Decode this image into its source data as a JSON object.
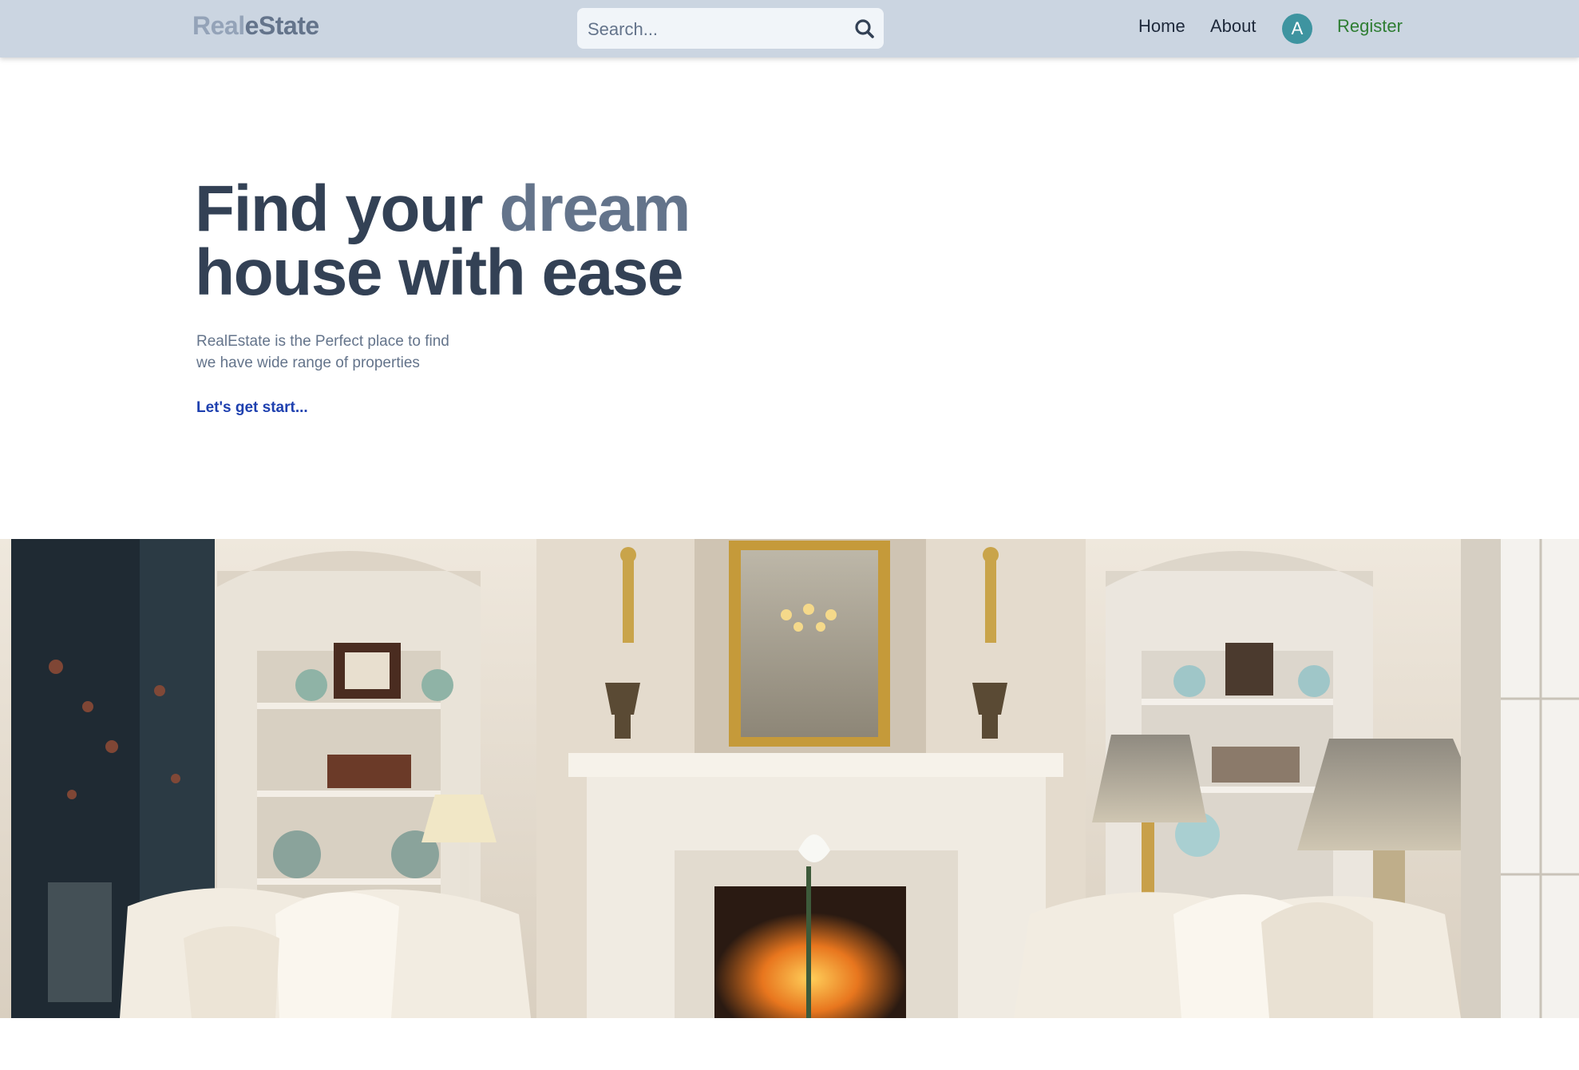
{
  "nav": {
    "logo_part1": "Real",
    "logo_part2": "eState",
    "search_placeholder": "Search...",
    "links": {
      "home": "Home",
      "about": "About",
      "register": "Register"
    },
    "avatar_letter": "A"
  },
  "hero": {
    "headline_line1_prefix": "Find your ",
    "headline_line1_accent": "dream",
    "headline_line2": "house with ease",
    "subtext_line1": "RealEstate is the Perfect place to find",
    "subtext_line2": "we have wide range of properties",
    "cta": "Let's get start..."
  },
  "colors": {
    "navbar_bg": "#cbd5e1",
    "heading": "#334155",
    "accent": "#64748b",
    "link": "#1e40af",
    "register": "#2e7d32",
    "avatar": "#3e94a0"
  }
}
